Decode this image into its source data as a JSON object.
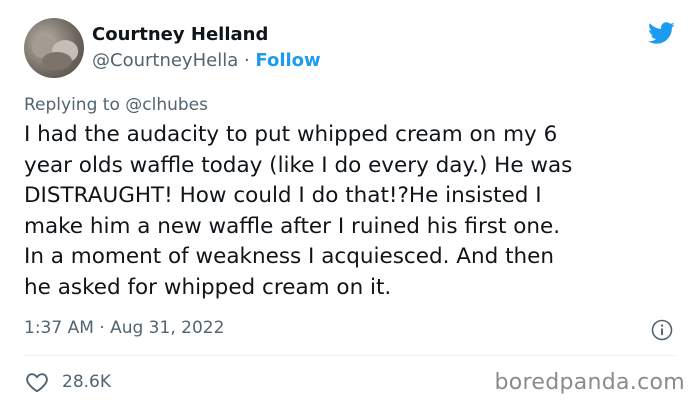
{
  "tweet": {
    "author_name": "Courtney Helland",
    "author_handle": "@CourtneyHella",
    "separator": " · ",
    "follow_label": "Follow",
    "reply_prefix": "Replying to ",
    "reply_handle": "@clhubes",
    "body_lines": [
      "I had the audacity to put whipped cream on my 6",
      "year olds waffle today (like I do every day.) He was",
      "DISTRAUGHT! How could I do that!?He insisted I",
      "make him a new waffle after I ruined his first one.",
      "In a moment of weakness I acquiesced. And then",
      "he asked for whipped cream on it."
    ],
    "timestamp": "1:37 AM · Aug 31, 2022",
    "like_count": "28.6K"
  },
  "watermark": "boredpanda.com",
  "icons": {
    "brand": "twitter-bird-icon",
    "info": "info-icon",
    "like": "heart-icon"
  },
  "colors": {
    "accent": "#1d9bf0",
    "text": "#0f1419",
    "secondary": "#536471",
    "watermark": "#8b8b8b"
  }
}
